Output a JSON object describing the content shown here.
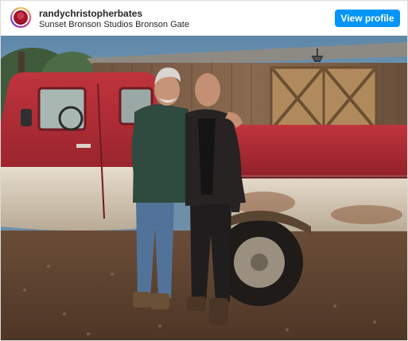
{
  "post": {
    "username": "randychristopherbates",
    "location": "Sunset Bronson Studios Bronson Gate",
    "view_profile_label": "View profile"
  },
  "icons": {
    "avatar": "profile-avatar"
  },
  "colors": {
    "button": "#0095f6",
    "truck": "#b6313a"
  }
}
